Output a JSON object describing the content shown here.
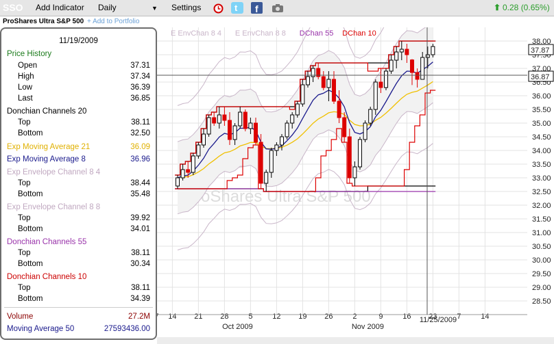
{
  "toolbar": {
    "ticker": "SSO",
    "add_indicator": "Add Indicator",
    "period": "Daily",
    "period_arrow": "▼",
    "settings": "Settings",
    "change": "0.28 (0.65%)",
    "change_arrow": "⬆",
    "alarm_icon": "alarm-clock-icon",
    "twitter_icon": "twitter-icon",
    "facebook_icon": "facebook-icon",
    "camera_icon": "camera-icon"
  },
  "subheader": {
    "name": "ProShares Ultra S&P 500",
    "add_link": "+ Add to Portfolio"
  },
  "legend": [
    {
      "label": "E EnvChan 8 4",
      "color": "#c9b6c9"
    },
    {
      "label": "E EnvChan 8 8",
      "color": "#c9b6c9"
    },
    {
      "label": "DChan 55",
      "color": "#9933aa"
    },
    {
      "label": "DChan 10",
      "color": "#dd0000"
    }
  ],
  "panel": {
    "date": "11/19/2009",
    "price_history": "Price History",
    "open_label": "Open",
    "open": "37.31",
    "high_label": "High",
    "high": "37.34",
    "low_label": "Low",
    "low": "36.39",
    "last_label": "Last",
    "last": "36.85",
    "dc20": "Donchian Channels 20",
    "dc20_top_label": "Top",
    "dc20_top": "38.11",
    "dc20_bottom_label": "Bottom",
    "dc20_bottom": "32.50",
    "ema21_label": "Exp Moving Average 21",
    "ema21": "36.09",
    "ema8_label": "Exp Moving Average 8",
    "ema8": "36.96",
    "env84": "Exp Envelope Channel 8 4",
    "env84_top_label": "Top",
    "env84_top": "38.44",
    "env84_bottom_label": "Bottom",
    "env84_bottom": "35.48",
    "env88": "Exp Envelope Channel 8 8",
    "env88_top_label": "Top",
    "env88_top": "39.92",
    "env88_bottom_label": "Bottom",
    "env88_bottom": "34.01",
    "dc55": "Donchian Channels 55",
    "dc55_top_label": "Top",
    "dc55_top": "38.11",
    "dc55_bottom_label": "Bottom",
    "dc55_bottom": "30.34",
    "dc10": "Donchian Channels 10",
    "dc10_top_label": "Top",
    "dc10_top": "38.11",
    "dc10_bottom_label": "Bottom",
    "dc10_bottom": "34.39",
    "volume_label": "Volume",
    "volume": "27.2M",
    "ma50_label": "Moving Average 50",
    "ma50": "27593436.00"
  },
  "colors": {
    "dc20": "#000000",
    "ema21": "#f0c000",
    "ema8": "#1a1a8c",
    "env": "#c9b6c9",
    "dc55": "#9933aa",
    "dc10": "#dd0000",
    "up": "#000000",
    "down": "#dd0000"
  },
  "chart_data": {
    "type": "line",
    "watermark_symbol": "SSO",
    "watermark_name": "ProShares Ultra S&P 500",
    "y_ticks": [
      "38.00",
      "37.50",
      "37.00",
      "36.50",
      "36.00",
      "35.50",
      "35.00",
      "34.50",
      "34.00",
      "33.50",
      "33.00",
      "32.50",
      "32.00",
      "31.50",
      "31.00",
      "30.50",
      "30.00",
      "29.50",
      "29.00",
      "28.50"
    ],
    "ylim": [
      28.5,
      38.0
    ],
    "price_badges": [
      "37.87",
      "36.87"
    ],
    "cursor_date": "11/25/2009",
    "x_labels": [
      {
        "x": -4,
        "label": "7"
      },
      {
        "x": -1,
        "label": "14"
      },
      {
        "x": 4,
        "label": "21"
      },
      {
        "x": 9,
        "label": "28"
      },
      {
        "x": 14,
        "label": "5"
      },
      {
        "x": 19,
        "label": "12"
      },
      {
        "x": 24,
        "label": "19"
      },
      {
        "x": 29,
        "label": "26"
      },
      {
        "x": 34,
        "label": "2"
      },
      {
        "x": 39,
        "label": "9"
      },
      {
        "x": 44,
        "label": "16"
      },
      {
        "x": 49,
        "label": "23"
      },
      {
        "x": 54,
        "label": "7"
      },
      {
        "x": 59,
        "label": "14"
      }
    ],
    "month_labels": [
      {
        "x": 11.5,
        "label": "Oct 2009"
      },
      {
        "x": 36.5,
        "label": "Nov 2009"
      }
    ],
    "candles": [
      [
        32.7,
        33.1,
        32.6,
        33.0
      ],
      [
        33.0,
        33.5,
        32.9,
        33.3
      ],
      [
        33.3,
        33.6,
        33.0,
        33.2
      ],
      [
        33.2,
        33.9,
        33.1,
        33.8
      ],
      [
        33.8,
        34.3,
        33.7,
        34.2
      ],
      [
        34.2,
        34.8,
        34.1,
        34.6
      ],
      [
        34.6,
        35.3,
        34.5,
        35.2
      ],
      [
        35.2,
        35.4,
        34.9,
        35.0
      ],
      [
        35.0,
        35.6,
        34.8,
        35.3
      ],
      [
        35.3,
        35.6,
        34.9,
        35.1
      ],
      [
        35.1,
        35.4,
        34.2,
        34.4
      ],
      [
        34.4,
        35.0,
        34.2,
        34.9
      ],
      [
        34.9,
        35.6,
        34.8,
        35.4
      ],
      [
        35.4,
        35.5,
        34.7,
        34.8
      ],
      [
        34.8,
        35.2,
        34.6,
        35.0
      ],
      [
        35.0,
        35.2,
        34.2,
        34.3
      ],
      [
        34.3,
        34.6,
        32.6,
        32.8
      ],
      [
        32.8,
        33.3,
        32.5,
        33.2
      ],
      [
        33.2,
        34.1,
        33.0,
        34.0
      ],
      [
        34.0,
        34.3,
        33.8,
        34.2
      ],
      [
        34.2,
        34.6,
        34.0,
        34.5
      ],
      [
        34.5,
        35.1,
        34.4,
        35.0
      ],
      [
        35.0,
        35.4,
        34.8,
        35.3
      ],
      [
        35.3,
        35.8,
        35.2,
        35.7
      ],
      [
        35.7,
        36.6,
        35.6,
        36.4
      ],
      [
        36.4,
        36.9,
        36.3,
        36.7
      ],
      [
        36.7,
        37.1,
        36.5,
        37.0
      ],
      [
        37.0,
        37.2,
        36.6,
        36.7
      ],
      [
        36.7,
        36.9,
        36.2,
        36.3
      ],
      [
        36.3,
        36.9,
        35.8,
        36.6
      ],
      [
        36.6,
        36.9,
        35.7,
        35.8
      ],
      [
        35.8,
        36.2,
        35.0,
        35.2
      ],
      [
        35.2,
        35.4,
        34.3,
        34.5
      ],
      [
        34.5,
        34.8,
        32.8,
        33.0
      ],
      [
        33.0,
        33.6,
        32.7,
        33.4
      ],
      [
        33.4,
        34.5,
        33.3,
        34.4
      ],
      [
        34.4,
        35.1,
        34.3,
        35.0
      ],
      [
        35.0,
        35.6,
        34.9,
        35.5
      ],
      [
        35.5,
        36.6,
        35.3,
        36.5
      ],
      [
        36.5,
        37.0,
        36.1,
        36.3
      ],
      [
        36.3,
        37.0,
        36.2,
        36.9
      ],
      [
        36.9,
        37.5,
        36.8,
        37.3
      ],
      [
        37.3,
        37.8,
        37.0,
        37.6
      ],
      [
        37.6,
        38.0,
        37.3,
        37.7
      ],
      [
        37.7,
        37.9,
        37.2,
        37.5
      ],
      [
        37.31,
        37.34,
        36.39,
        36.85
      ],
      [
        36.85,
        37.0,
        36.3,
        36.6
      ],
      [
        36.6,
        37.6,
        36.6,
        37.4
      ],
      [
        37.4,
        37.8,
        37.0,
        37.5
      ],
      [
        37.5,
        37.9,
        37.4,
        37.8
      ]
    ]
  }
}
